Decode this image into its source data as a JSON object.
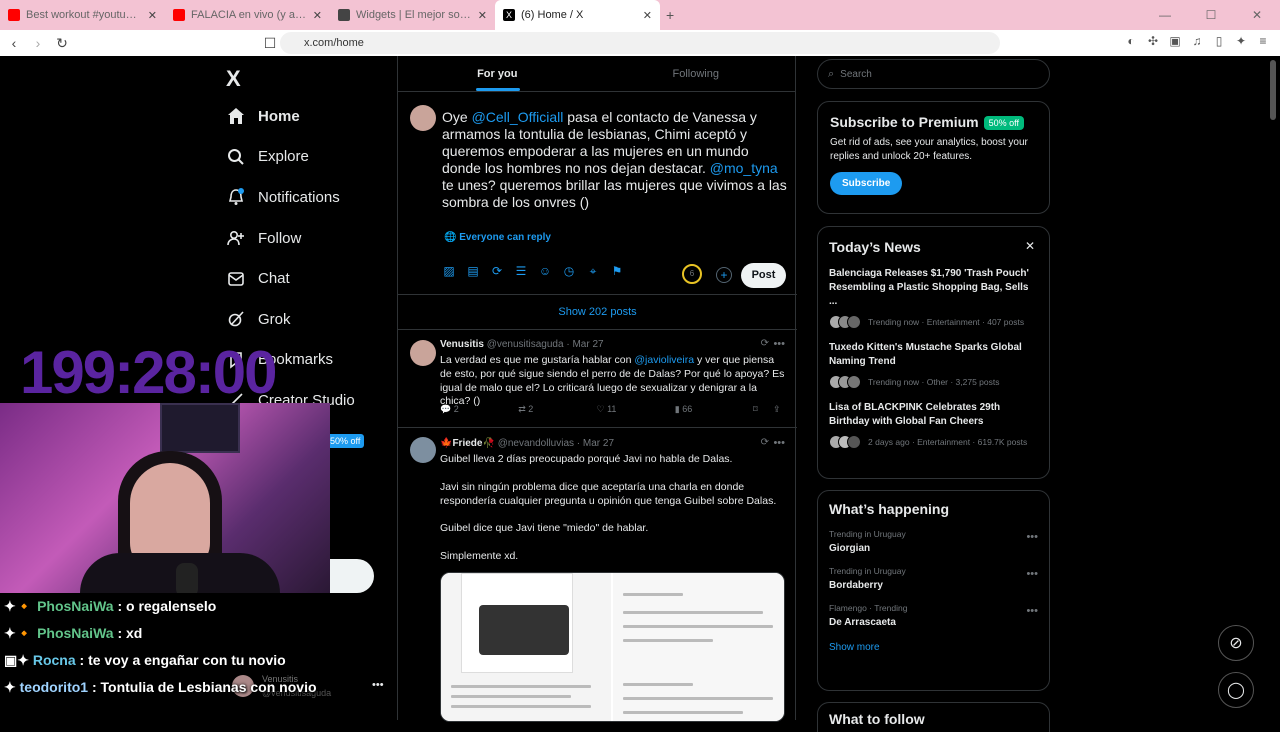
{
  "browser": {
    "tabs": [
      {
        "label": "Best workout #youtubeshorts #mem...",
        "favicon_color": "#ff0000"
      },
      {
        "label": "FALACIA en vivo (y a todo color) - Re...",
        "favicon_color": "#ff0000"
      },
      {
        "label": "Widgets | El mejor software para pod...",
        "favicon_color": "#444444"
      },
      {
        "label": "(6) Home / X",
        "favicon_color": "#000000"
      }
    ],
    "new_tab": "+",
    "url": "x.com/home"
  },
  "sidebar": {
    "logo": "X",
    "items": [
      {
        "label": "Home",
        "icon": "home-icon"
      },
      {
        "label": "Explore",
        "icon": "search-icon"
      },
      {
        "label": "Notifications",
        "icon": "bell-icon"
      },
      {
        "label": "Follow",
        "icon": "add-person-icon"
      },
      {
        "label": "Chat",
        "icon": "mail-icon"
      },
      {
        "label": "Grok",
        "icon": "grok-icon"
      },
      {
        "label": "Bookmarks",
        "icon": "bookmark-icon"
      },
      {
        "label": "Creator Studio",
        "icon": "creator-icon"
      }
    ],
    "premium_badge": "50% off"
  },
  "overlay": {
    "timer": "199:28:00",
    "chat": [
      {
        "user": "PhosNaiWa",
        "msg": " : o regalenselo"
      },
      {
        "user": "PhosNaiWa",
        "msg": " : xd"
      },
      {
        "user": "Rocna",
        "msg": " : te voy a engañar con tu novio"
      },
      {
        "user": "teodorito1",
        "msg": " : Tontulia de Lesbianas con novio"
      }
    ],
    "bg_account_name": "Venusitis",
    "bg_account_handle": "@venusitisaguda"
  },
  "main": {
    "tabs": [
      "For you",
      "Following"
    ],
    "compose": {
      "text_parts": [
        {
          "t": "Oye ",
          "mention": false
        },
        {
          "t": "@Cell_Officiall",
          "mention": true
        },
        {
          "t": " pasa el contacto de Vanessa y armamos la tontulia de lesbianas, Chimi aceptó y queremos empoderar a las mujeres en un mundo donde los hombres no nos dejan destacar. ",
          "mention": false
        },
        {
          "t": "@mo_tyna",
          "mention": true
        },
        {
          "t": "  te unes? queremos brillar las mujeres que vivimos a las sombra de los onvres ()",
          "mention": false
        }
      ],
      "reply_setting": "Everyone can reply",
      "char_count": "6",
      "post_label": "Post"
    },
    "show_posts": "Show 202 posts",
    "tweets": [
      {
        "name": "Venusitis",
        "handle": "@venusitisaguda",
        "date": "Mar 27",
        "body_pre": "La verdad es que me gustaría hablar con ",
        "mention": "@javioliveira",
        "body_post": " y ver que piensa de esto, por qué sigue siendo el perro de de Dalas? Por qué lo apoya? Es igual de malo que el? Lo criticará luego de sexualizar y denigrar a la chica? ()",
        "replies": "2",
        "retweets": "2",
        "likes": "11",
        "views": "66"
      },
      {
        "name": "🍁Friede🥀",
        "handle": "@nevandolluvias",
        "date": "Mar 27",
        "p1": "Guibel lleva 2 días preocupado porqué Javi no habla de Dalas.",
        "p2": "Javi sin ningún problema dice que aceptaría una charla en donde respondería cualquier pregunta u opinión que tenga Guibel sobre Dalas.",
        "p3": "Guibel dice que Javi tiene \"miedo\" de hablar.",
        "p4": "Simplemente xd."
      }
    ]
  },
  "right": {
    "search_placeholder": "Search",
    "premium": {
      "title": "Subscribe to Premium",
      "badge": "50% off",
      "desc": "Get rid of ads, see your analytics, boost your replies and unlock 20+ features.",
      "button": "Subscribe"
    },
    "news": {
      "title": "Today’s News",
      "items": [
        {
          "title": "Balenciaga Releases $1,790 'Trash Pouch' Resembling a Plastic Shopping Bag, Sells ...",
          "meta": "Trending now · Entertainment · 407 posts"
        },
        {
          "title": "Tuxedo Kitten's Mustache Sparks Global Naming Trend",
          "meta": "Trending now · Other · 3,275 posts"
        },
        {
          "title": "Lisa of BLACKPINK Celebrates 29th Birthday with Global Fan Cheers",
          "meta": "2 days ago · Entertainment · 619.7K posts"
        }
      ]
    },
    "happening": {
      "title": "What’s happening",
      "items": [
        {
          "context": "Trending in Uruguay",
          "topic": "Giorgian"
        },
        {
          "context": "Trending in Uruguay",
          "topic": "Bordaberry"
        },
        {
          "context": "Flamengo · Trending",
          "topic": "De Arrascaeta"
        }
      ],
      "show_more": "Show more"
    },
    "who_to_follow": "What to follow"
  }
}
